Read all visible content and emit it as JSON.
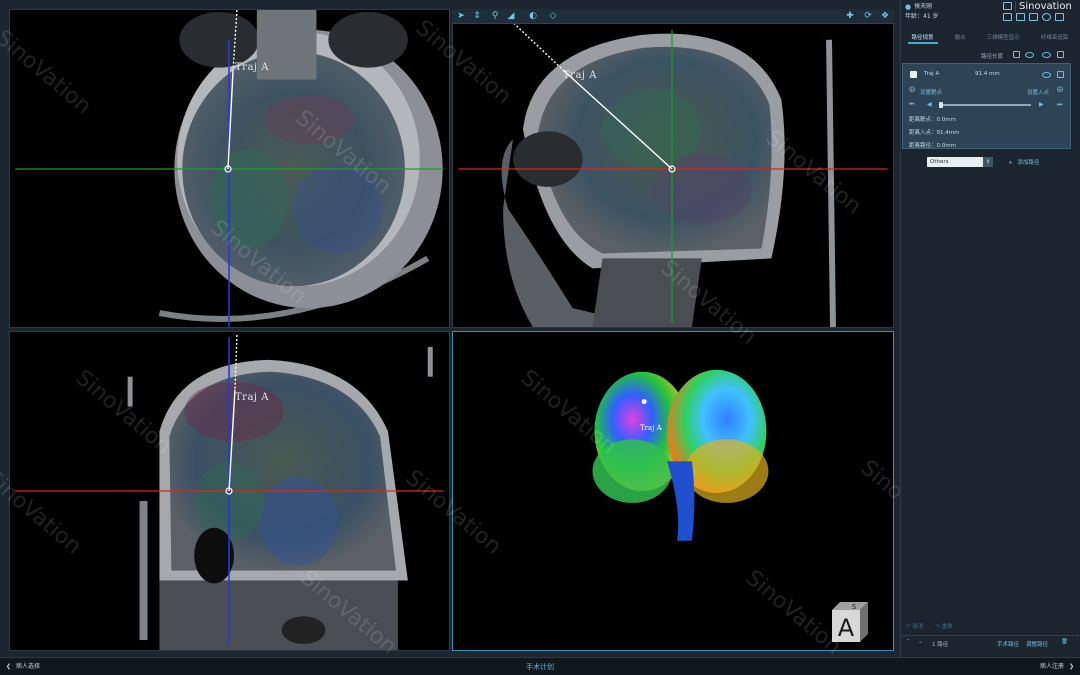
{
  "patient": {
    "name": "候天刚",
    "age_label": "年龄：41 岁"
  },
  "brand": "Sinovation",
  "watermark": "SinoVation",
  "tabs": [
    {
      "label": "路径规意",
      "active": true
    },
    {
      "label": "融合",
      "active": false
    },
    {
      "label": "三维模型显示",
      "active": false
    },
    {
      "label": "纤维束追踪",
      "active": false
    }
  ],
  "trajectory_panel": {
    "header_label": "路径长度",
    "trajectory": {
      "name": "Traj A",
      "length": "91.4 mm",
      "set_target_label": "设置靶点",
      "set_entry_label": "设置入点",
      "dist_target": "距离靶点：0.0mm",
      "dist_entry": "距离入点：91.4mm",
      "dist_path": "距离路径：0.0mm"
    },
    "type_select": {
      "value": "Others"
    },
    "add_path_label": "添加路径",
    "undo_label": "撤消",
    "redo_label": "重做",
    "count_label": "1 路径",
    "surgery_path_label": "手术路径",
    "adjust_path_label": "调整路径"
  },
  "viewports": {
    "axial": {
      "traj_label": "Traj A"
    },
    "sagittal": {
      "traj_label": "Traj A"
    },
    "coronal": {
      "traj_label": "Traj A"
    },
    "threed": {
      "traj_label": "Traj A",
      "cube_front": "A",
      "cube_top": "S"
    }
  },
  "toolbar_icons": [
    "pointer-icon",
    "pan-icon",
    "zoom-icon",
    "window-level-icon",
    "contrast-icon",
    "measure-icon",
    "crosshair-icon",
    "rotate-icon",
    "reset-icon"
  ],
  "bottom_bar": {
    "back_label": "病人选择",
    "center_label": "手术计划",
    "next_label": "病人注册"
  },
  "colors": {
    "accent": "#4fa6c8",
    "axis_red": "#e02020",
    "axis_green": "#1f9a2a",
    "axis_blue": "#2a36d8"
  }
}
